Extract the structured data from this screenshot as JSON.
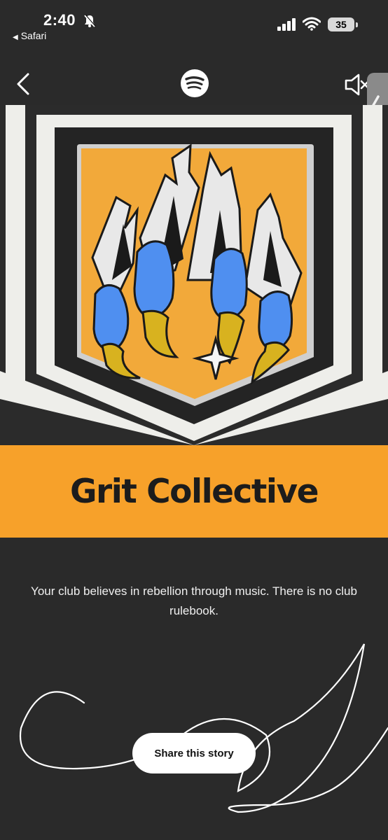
{
  "status_bar": {
    "time": "2:40",
    "back_app": "Safari",
    "battery": "35"
  },
  "header": {
    "logo": "spotify-logo",
    "back_icon": "chevron-left-icon",
    "sound_icon": "speaker-muted-icon"
  },
  "story": {
    "title": "Grit Collective",
    "description": "Your club believes in rebellion through music. There is no club rulebook.",
    "share_label": "Share this story"
  },
  "colors": {
    "background": "#2a2a2a",
    "banner": "#f7a12a",
    "badge": "#f2a93a",
    "claw_blue": "#4f8ff0",
    "talon_yellow": "#d8b21f"
  }
}
